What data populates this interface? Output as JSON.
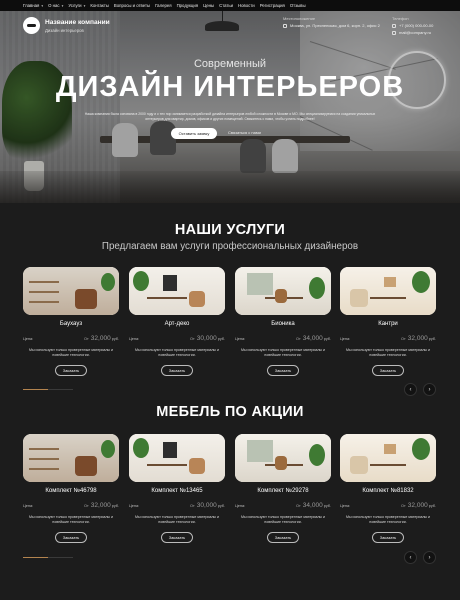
{
  "nav": {
    "items": [
      {
        "label": "Главная",
        "dropdown": true
      },
      {
        "label": "О нас",
        "dropdown": true
      },
      {
        "label": "Услуги",
        "dropdown": true
      },
      {
        "label": "Контакты",
        "dropdown": false
      },
      {
        "label": "Вопросы и ответы",
        "dropdown": false
      },
      {
        "label": "Галерея",
        "dropdown": false
      },
      {
        "label": "Продукция",
        "dropdown": false
      },
      {
        "label": "Цены",
        "dropdown": false
      },
      {
        "label": "Статьи",
        "dropdown": false
      },
      {
        "label": "Новости",
        "dropdown": false
      },
      {
        "label": "Регистрация",
        "dropdown": false
      },
      {
        "label": "Отзывы",
        "dropdown": false
      }
    ]
  },
  "brand": {
    "name": "Название компании",
    "tagline": "Дизайн интерьеров"
  },
  "contacts": {
    "address_label": "Местоположение",
    "address": "Москва, ул. Пресненская, дом 6, корп. 2, офис 2",
    "phone_label": "Телефон",
    "phone": "+7 (000) 000-00-00",
    "email": "mail@company.ru"
  },
  "hero": {
    "subtitle": "Современный",
    "title": "ДИЗАЙН ИНТЕРЬЕРОВ",
    "description": "Наша компания была основана в 2000 году и с тех пор занимается разработкой дизайна интерьеров любой сложности в Москве и МО. Мы специализируемся на создании уникальных интерьеров для квартир, домов, офисов и других помещений. Свяжитесь с нами, чтобы узнать подробнее!",
    "cta_primary": "Оставить заявку",
    "cta_secondary": "Связаться с нами"
  },
  "services": {
    "title": "НАШИ УСЛУГИ",
    "subtitle": "Предлагаем вам услуги профессиональных дизайнеров",
    "progress": 0.5,
    "cards": [
      {
        "name": "Баухауз",
        "price_label": "Цена:",
        "from": "От",
        "amount": "32,000",
        "unit": "руб.",
        "desc": "Мы используют только проверенные материалы и новейшие технологии.",
        "button": "Заказать"
      },
      {
        "name": "Арт-деко",
        "price_label": "Цена:",
        "from": "От",
        "amount": "30,000",
        "unit": "руб.",
        "desc": "Мы используют только проверенные материалы и новейшие технологии.",
        "button": "Заказать"
      },
      {
        "name": "Бионика",
        "price_label": "Цена:",
        "from": "От",
        "amount": "34,000",
        "unit": "руб.",
        "desc": "Мы используют только проверенные материалы и новейшие технологии.",
        "button": "Заказать"
      },
      {
        "name": "Кантри",
        "price_label": "Цена:",
        "from": "От",
        "amount": "32,000",
        "unit": "руб.",
        "desc": "Мы используют только проверенные материалы и новейшие технологии.",
        "button": "Заказать"
      }
    ]
  },
  "furniture": {
    "title": "МЕБЕЛЬ ПО АКЦИИ",
    "progress": 0.5,
    "cards": [
      {
        "name": "Комплект №46798",
        "price_label": "Цена:",
        "from": "От",
        "amount": "32,000",
        "unit": "руб.",
        "desc": "Мы используют только проверенные материалы и новейшие технологии.",
        "button": "Заказать"
      },
      {
        "name": "Комплект №13465",
        "price_label": "Цена:",
        "from": "От",
        "amount": "30,000",
        "unit": "руб.",
        "desc": "Мы используют только проверенные материалы и новейшие технологии.",
        "button": "Заказать"
      },
      {
        "name": "Комплект №29278",
        "price_label": "Цена:",
        "from": "От",
        "amount": "34,000",
        "unit": "руб.",
        "desc": "Мы используют только проверенные материалы и новейшие технологии.",
        "button": "Заказать"
      },
      {
        "name": "Комплект №81832",
        "price_label": "Цена:",
        "from": "От",
        "amount": "32,000",
        "unit": "руб.",
        "desc": "Мы используют только проверенные материалы и новейшие технологии.",
        "button": "Заказать"
      }
    ]
  },
  "icons": {
    "arrow_prev": "chevron-left-icon",
    "arrow_next": "chevron-right-icon",
    "location": "location-icon",
    "phone": "phone-icon",
    "email": "mail-icon"
  },
  "colors": {
    "page_bg": "#1c1c1c",
    "accent": "#b3844f",
    "nav_bg": "#0d0d0d"
  }
}
